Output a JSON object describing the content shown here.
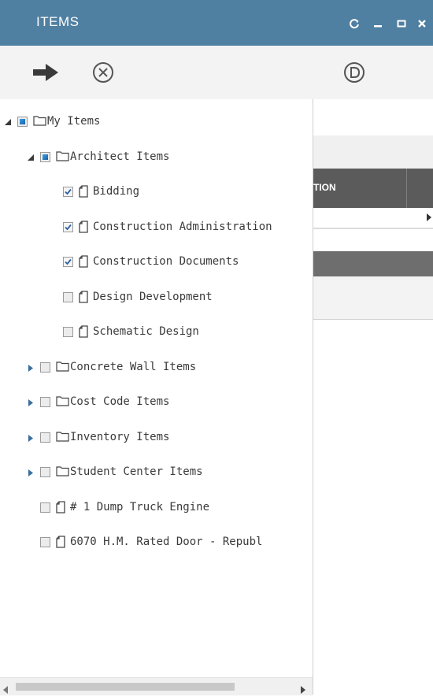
{
  "window": {
    "title": "ITEMS"
  },
  "toolbar": {
    "buttons": [
      {
        "icon": "arrow-right-icon"
      },
      {
        "icon": "cancel-circle-icon"
      },
      {
        "icon": "d-circle-icon"
      }
    ]
  },
  "background_grid": {
    "header_fragment": "TION"
  },
  "tree": {
    "nodes": [
      {
        "label": "My Items",
        "level": 0,
        "expander": "expanded",
        "check": "partial",
        "icon": "folder-icon"
      },
      {
        "label": "Architect Items",
        "level": 1,
        "expander": "expanded",
        "check": "partial",
        "icon": "folder-icon"
      },
      {
        "label": "Bidding",
        "level": 2,
        "expander": "none",
        "check": "checked",
        "icon": "document-icon"
      },
      {
        "label": "Construction Administration",
        "level": 2,
        "expander": "none",
        "check": "checked",
        "icon": "document-icon"
      },
      {
        "label": "Construction Documents",
        "level": 2,
        "expander": "none",
        "check": "checked",
        "icon": "document-icon"
      },
      {
        "label": "Design Development",
        "level": 2,
        "expander": "none",
        "check": "unchecked",
        "icon": "document-icon"
      },
      {
        "label": "Schematic Design",
        "level": 2,
        "expander": "none",
        "check": "unchecked",
        "icon": "document-icon"
      },
      {
        "label": "Concrete Wall Items",
        "level": 1,
        "expander": "collapsed",
        "check": "unchecked",
        "icon": "folder-icon"
      },
      {
        "label": "Cost Code Items",
        "level": 1,
        "expander": "collapsed",
        "check": "unchecked",
        "icon": "folder-icon"
      },
      {
        "label": "Inventory Items",
        "level": 1,
        "expander": "collapsed",
        "check": "unchecked",
        "icon": "folder-icon"
      },
      {
        "label": "Student Center Items",
        "level": 1,
        "expander": "collapsed",
        "check": "unchecked",
        "icon": "folder-icon"
      },
      {
        "label": "# 1 Dump Truck Engine",
        "level": 1,
        "expander": "none",
        "check": "unchecked",
        "icon": "document-icon"
      },
      {
        "label": "6070 H.M. Rated Door - Republ",
        "level": 1,
        "expander": "none",
        "check": "unchecked",
        "icon": "document-icon"
      }
    ]
  },
  "colors": {
    "titlebar": "#4f7fa1",
    "grid_header": "#5b5b5b",
    "partial_check": "#1c5fa8"
  }
}
